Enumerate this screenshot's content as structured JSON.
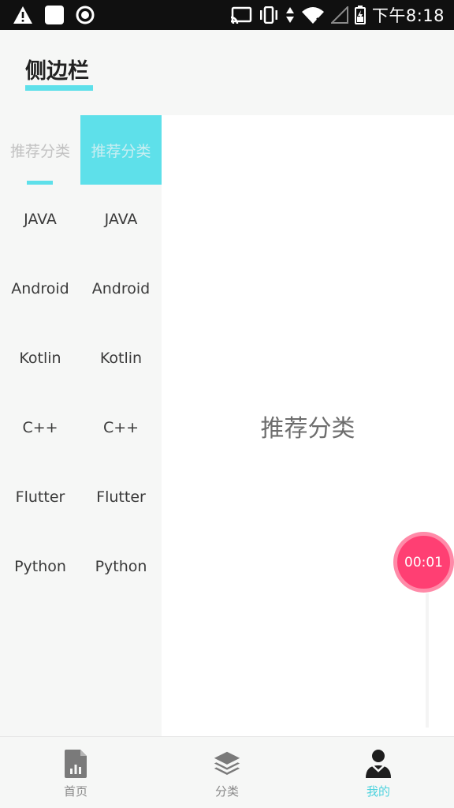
{
  "status_bar": {
    "time": "下午8:18",
    "left_icons": [
      "warning-icon",
      "square-app-icon",
      "record-icon"
    ],
    "right_icons": [
      "cast-icon",
      "vibrate-icon",
      "data-arrows-icon",
      "wifi-icon",
      "signal-icon",
      "battery-icon"
    ]
  },
  "header": {
    "title": "侧边栏",
    "accent_color": "#5ee0ea"
  },
  "sidebar": {
    "left_column": {
      "head": "推荐分类",
      "items": [
        "JAVA",
        "Android",
        "Kotlin",
        "C++",
        "Flutter",
        "Python"
      ]
    },
    "right_column": {
      "head": "推荐分类",
      "items": [
        "JAVA",
        "Android",
        "Kotlin",
        "C++",
        "Flutter",
        "Python"
      ]
    }
  },
  "main": {
    "content_text": "推荐分类"
  },
  "floating_timer": {
    "text": "00:01",
    "color": "#ff3f73"
  },
  "bottom_nav": {
    "items": [
      {
        "label": "首页",
        "icon": "document-chart-icon",
        "active": false
      },
      {
        "label": "分类",
        "icon": "layers-icon",
        "active": false
      },
      {
        "label": "我的",
        "icon": "person-icon",
        "active": true
      }
    ],
    "active_color": "#4fd3de"
  }
}
